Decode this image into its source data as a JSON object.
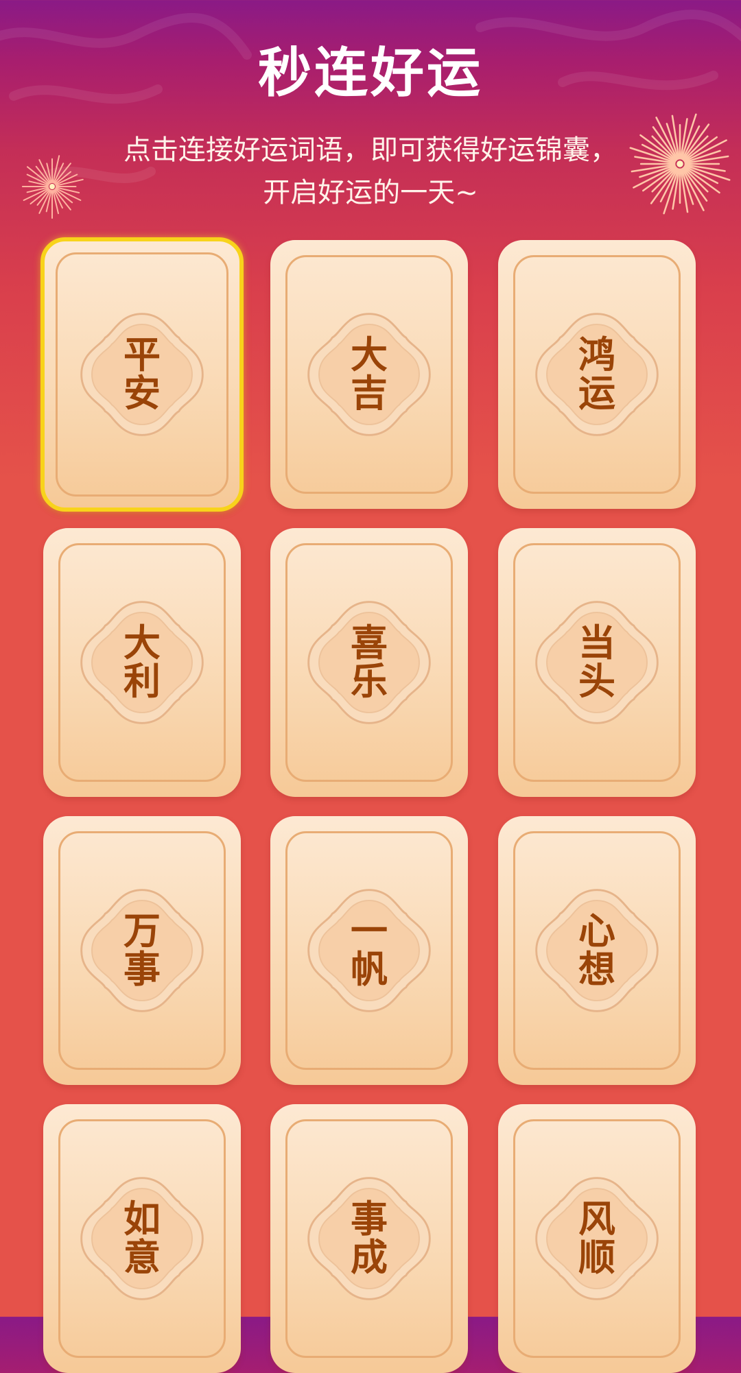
{
  "header": {
    "title": "秒连好运",
    "subtitle_line1": "点击连接好运词语，即可获得好运锦囊，",
    "subtitle_line2": "开启好运的一天~"
  },
  "cards": [
    {
      "text": "平安",
      "selected": true
    },
    {
      "text": "大吉",
      "selected": false
    },
    {
      "text": "鸿运",
      "selected": false
    },
    {
      "text": "大利",
      "selected": false
    },
    {
      "text": "喜乐",
      "selected": false
    },
    {
      "text": "当头",
      "selected": false
    },
    {
      "text": "万事",
      "selected": false
    },
    {
      "text": "一帆",
      "selected": false
    },
    {
      "text": "心想",
      "selected": false
    },
    {
      "text": "如意",
      "selected": false
    },
    {
      "text": "事成",
      "selected": false
    },
    {
      "text": "风顺",
      "selected": false
    }
  ],
  "colors": {
    "card_text": "#9a4408",
    "selected_border": "#f8d31b",
    "background_top": "#8a1a86",
    "background_bottom": "#e5524a"
  }
}
